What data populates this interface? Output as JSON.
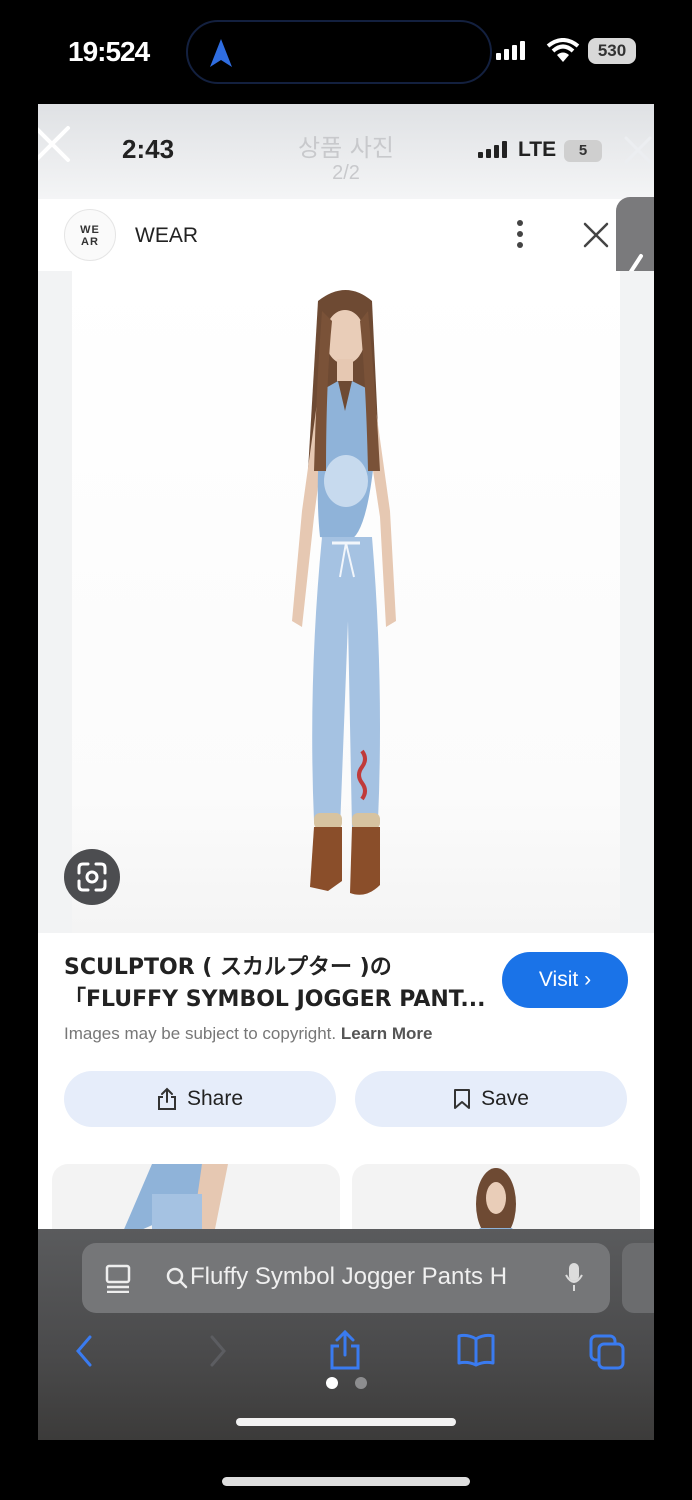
{
  "outer_status": {
    "time": "19:524",
    "battery": "530"
  },
  "inner_status": {
    "time": "2:43",
    "network": "LTE",
    "battery": "5"
  },
  "photo_viewer": {
    "title": "상품 사진",
    "count": "2/2"
  },
  "site": {
    "logo_text": "WE AR",
    "name": "WEAR"
  },
  "product": {
    "title_line1": "SCULPTOR ( スカルプター )の",
    "title_line2": "「FLUFFY SYMBOL JOGGER PANT...",
    "visit_label": "Visit",
    "copyright_text": "Images may be subject to copyright.",
    "learn_more": "Learn More"
  },
  "actions": {
    "share_label": "Share",
    "save_label": "Save"
  },
  "browser": {
    "url_text": "Fluffy Symbol Jogger Pants H"
  },
  "icons": {
    "island": "navigation-arrow-icon",
    "lens": "google-lens-icon",
    "back": "back-chevron-icon",
    "forward": "forward-chevron-icon",
    "share": "share-icon",
    "bookmarks": "book-icon",
    "tabs": "tabs-icon"
  },
  "colors": {
    "accent": "#1a73e8",
    "safari_blue": "#3a7bf0",
    "action_bg": "#e6edfa"
  }
}
